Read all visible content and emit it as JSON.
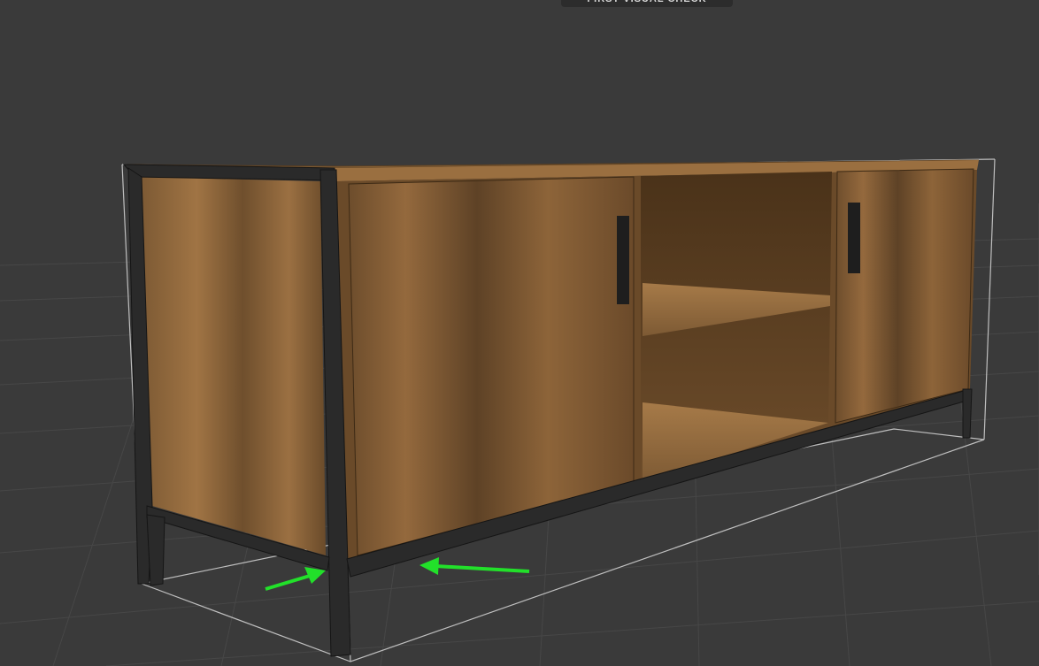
{
  "viewer": {
    "top_badge_label": "FIRST VISUAL CHECK",
    "background_color": "#3a3a3a",
    "grid_color": "#474747",
    "bounding_box_color": "#bfbfbf"
  },
  "model": {
    "subject": "wooden TV stand with black metal frame",
    "wood_color": "#8a6236",
    "frame_color": "#2a2a2a"
  },
  "annotations": {
    "arrow_color": "#22e02a",
    "arrow_count": 2
  }
}
